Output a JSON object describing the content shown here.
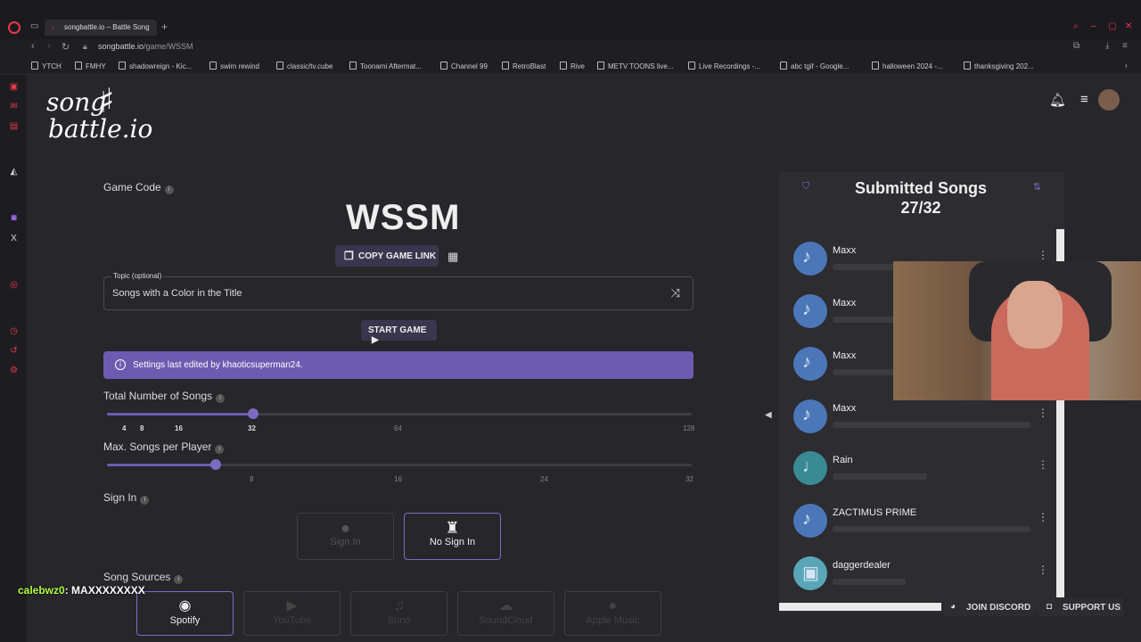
{
  "browser": {
    "tab_title": "songbattle.io – Battle Song",
    "url_domain": "songbattle.io",
    "url_path": "/game/WSSM",
    "bookmarks": [
      "YTCH",
      "FMHY",
      "shadowreign - Kic...",
      "swim rewind",
      "classic/tv.cube",
      "Toonami Aftermat...",
      "Channel 99",
      "RetroBlast",
      "Rive",
      "METV TOONS live...",
      "Live Recordings -...",
      "abc tgif - Google...",
      "halloween 2024 -...",
      "thanksgiving 202..."
    ]
  },
  "logo": {
    "line1": "song",
    "line2": "battle.io"
  },
  "game": {
    "code_label": "Game Code",
    "code": "WSSM",
    "copy_link_label": "COPY GAME LINK",
    "topic_label": "Topic (optional)",
    "topic_value": "Songs with a Color in the Title",
    "start_label": "START GAME",
    "banner_text": "Settings last edited by khaoticsuperman24."
  },
  "settings": {
    "total_songs_label": "Total Number of Songs",
    "total_songs_ticks": [
      "4",
      "8",
      "16",
      "32",
      "64",
      "128"
    ],
    "total_songs_value": 32,
    "max_songs_label": "Max. Songs per Player",
    "max_songs_ticks": [
      "8",
      "16",
      "24",
      "32"
    ],
    "max_songs_value": 4,
    "sign_in_label": "Sign In",
    "sign_in_options": [
      {
        "label": "Sign In",
        "selected": false
      },
      {
        "label": "No Sign In",
        "selected": true
      }
    ],
    "song_sources_label": "Song Sources",
    "song_sources": [
      {
        "label": "Spotify",
        "selected": true
      },
      {
        "label": "YouTube",
        "selected": false
      },
      {
        "label": "Suno",
        "selected": false
      },
      {
        "label": "SoundCloud",
        "selected": false
      },
      {
        "label": "Apple Music",
        "selected": false
      }
    ]
  },
  "submitted": {
    "title": "Submitted Songs",
    "count": "27/32",
    "players": [
      {
        "name": "Maxx"
      },
      {
        "name": "Maxx"
      },
      {
        "name": "Maxx"
      },
      {
        "name": "Maxx"
      },
      {
        "name": "Rain"
      },
      {
        "name": "ZACTIMUS PRIME"
      },
      {
        "name": "daggerdealer"
      }
    ]
  },
  "footer": {
    "discord": "JOIN DISCORD",
    "support": "SUPPORT US"
  },
  "chat": {
    "user": "calebwz0",
    "message": ": MAXXXXXXXX"
  },
  "colors": {
    "accent": "#6c5bb0",
    "background": "#26262b",
    "brand": "#e8394a"
  }
}
